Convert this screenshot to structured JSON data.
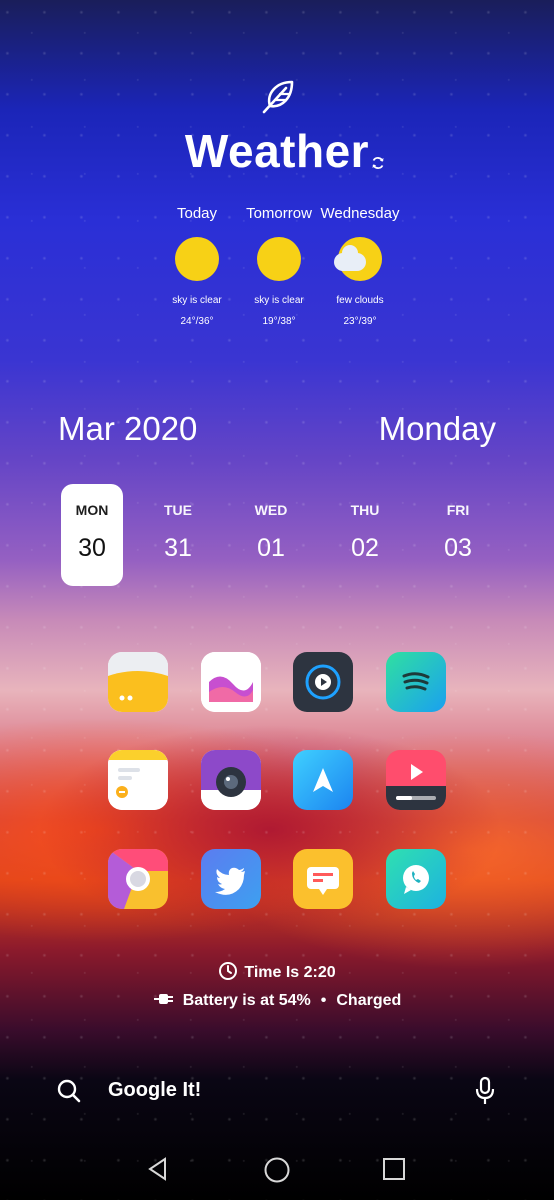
{
  "weather": {
    "title": "Weather",
    "forecast": [
      {
        "day": "Today",
        "condition": "sky is clear",
        "temp": "24°/36°",
        "icon": "sun-icon"
      },
      {
        "day": "Tomorrow",
        "condition": "sky is clear",
        "temp": "19°/38°",
        "icon": "sun-icon"
      },
      {
        "day": "Wednesday",
        "condition": "few clouds",
        "temp": "23°/39°",
        "icon": "partly-cloudy-icon"
      }
    ]
  },
  "calendar": {
    "month_year": "Mar 2020",
    "weekday": "Monday",
    "days": [
      {
        "name": "MON",
        "date": "30",
        "selected": true
      },
      {
        "name": "TUE",
        "date": "31"
      },
      {
        "name": "WED",
        "date": "01"
      },
      {
        "name": "THU",
        "date": "02"
      },
      {
        "name": "FRI",
        "date": "03"
      }
    ]
  },
  "apps": [
    "files-app-icon",
    "gallery-app-icon",
    "music-player-app-icon",
    "spotify-app-icon",
    "notes-app-icon",
    "camera-app-icon",
    "navigation-app-icon",
    "video-app-icon",
    "chrome-app-icon",
    "twitter-app-icon",
    "messages-app-icon",
    "whatsapp-app-icon"
  ],
  "status": {
    "time_label": "Time Is 2:20",
    "battery_label": "Battery is at 54%",
    "charge_state": "Charged"
  },
  "search": {
    "placeholder": "Google It!"
  },
  "colors": {
    "sun": "#f7d116",
    "selected_day_bg": "#ffffff"
  }
}
